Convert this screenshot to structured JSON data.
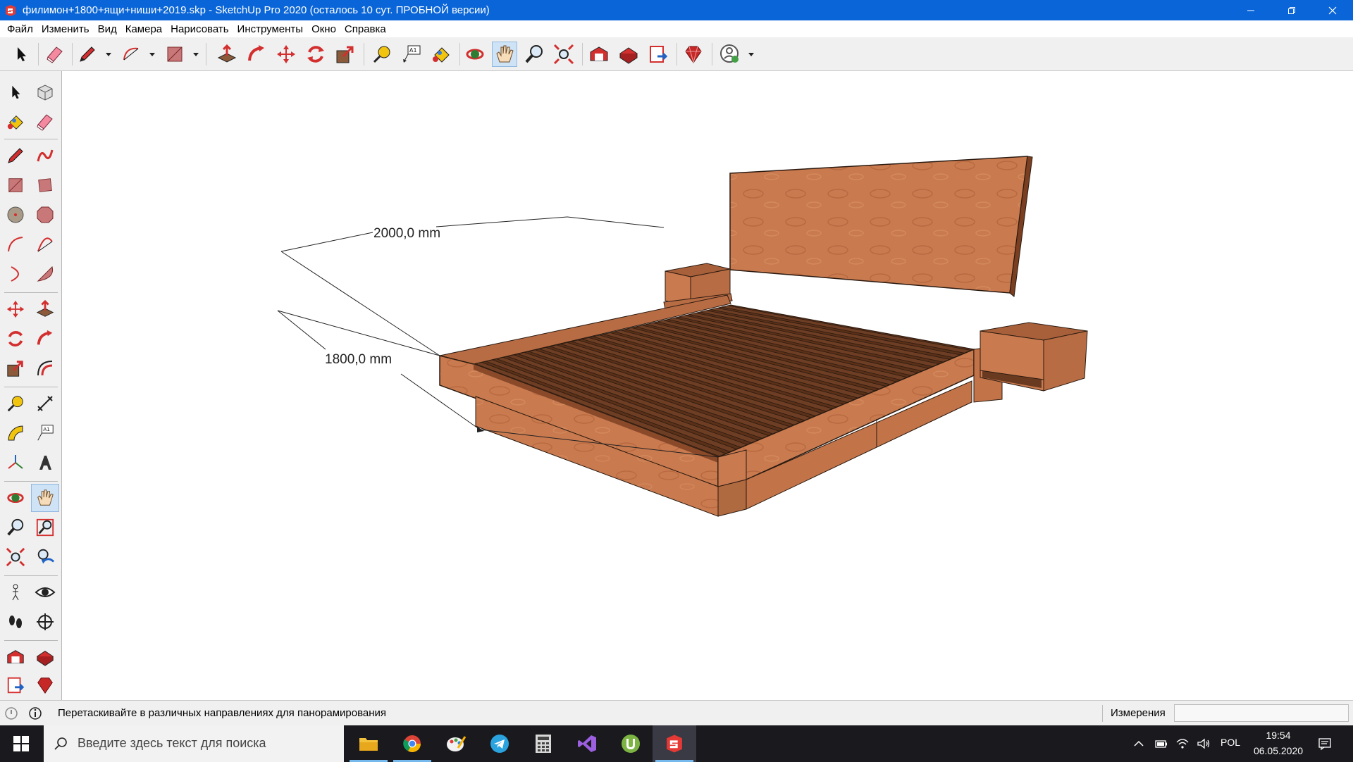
{
  "window": {
    "title": "филимон+1800+ящи+ниши+2019.skp - SketchUp Pro 2020 (осталось 10 сут. ПРОБНОЙ версии)"
  },
  "menu": {
    "items": [
      "Файл",
      "Изменить",
      "Вид",
      "Камера",
      "Нарисовать",
      "Инструменты",
      "Окно",
      "Справка"
    ]
  },
  "toolbar": {
    "tools": [
      "select-icon",
      "eraser-icon",
      "pencil-icon",
      "arc-icon",
      "rectangle-icon",
      "push-pull-icon",
      "follow-me-icon",
      "move-icon",
      "rotate-icon",
      "scale-icon",
      "tape-measure-icon",
      "text-icon",
      "paint-bucket-icon",
      "orbit-icon",
      "pan-icon",
      "zoom-icon",
      "zoom-extents-icon",
      "warehouse-icon",
      "extension-warehouse-icon",
      "layout-icon",
      "ruby-icon",
      "account-icon"
    ],
    "active_tool": "pan-icon"
  },
  "left_toolbar": {
    "active_tool": "pan-icon"
  },
  "viewport": {
    "dimension_length": "2000,0 mm",
    "dimension_width": "1800,0 mm",
    "colors": {
      "wood": "#c97a4f",
      "wood_dark": "#8a4a2a",
      "slat": "#6e3e24",
      "outline": "#2a1a10"
    }
  },
  "status": {
    "hint": "Перетаскивайте в различных направлениях для панорамирования",
    "measurements_label": "Измерения",
    "measurements_value": ""
  },
  "taskbar": {
    "search_placeholder": "Введите здесь текст для поиска",
    "apps": [
      "file-explorer-icon",
      "chrome-icon",
      "paint-icon",
      "telegram-icon",
      "calculator-icon",
      "visual-studio-icon",
      "utorrent-icon",
      "sketchup-icon"
    ],
    "active_app": "sketchup-icon",
    "language": "POL",
    "time": "19:54",
    "date": "06.05.2020"
  }
}
